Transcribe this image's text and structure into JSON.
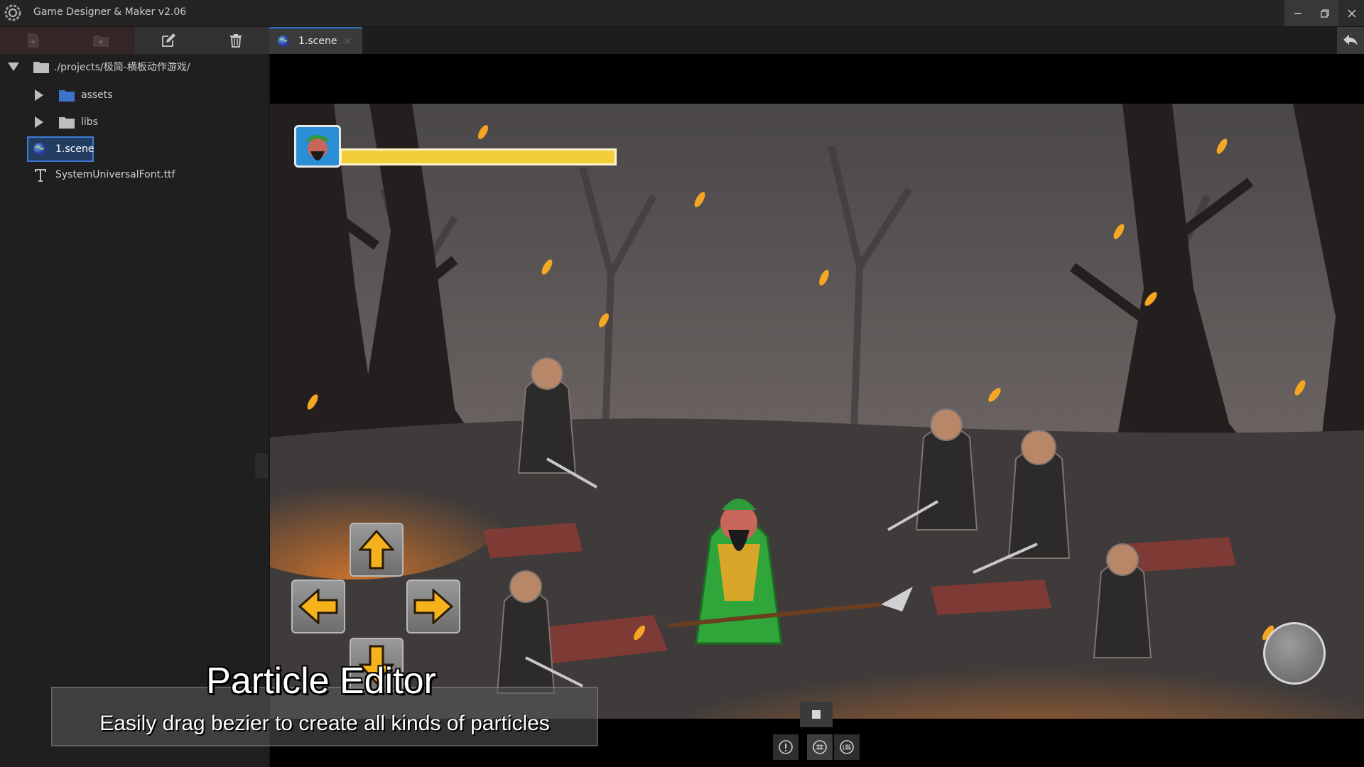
{
  "app": {
    "title": "Game Designer  &  Maker  v2.06"
  },
  "window_controls": {
    "minimize": "–",
    "maximize": "❐",
    "close": "✕"
  },
  "toolbar": {
    "icons": [
      "new-file-icon",
      "new-folder-icon",
      "edit-icon",
      "delete-icon"
    ]
  },
  "tabs": [
    {
      "label": "1.scene",
      "close": "✕",
      "active": true
    }
  ],
  "explorer": {
    "root": "./projects/极简-横板动作游戏/",
    "items": [
      {
        "label": "assets",
        "type": "folder",
        "color": "#3b73c8"
      },
      {
        "label": "libs",
        "type": "folder",
        "color": "#bdbdbd"
      },
      {
        "label": "1.scene",
        "type": "scene",
        "selected": true
      },
      {
        "label": "SystemUniversalFont.ttf",
        "type": "font"
      }
    ]
  },
  "game": {
    "hp_fraction": 1.0,
    "dpad": [
      "up-arrow-icon",
      "left-arrow-icon",
      "right-arrow-icon",
      "down-arrow-icon"
    ],
    "colors": {
      "hp": "#f2cf3a",
      "ember": "#f5a623",
      "ground": "#3f3b3a"
    }
  },
  "caption": {
    "title": "Particle Editor",
    "subtitle": "Easily drag bezier to create all kinds of particles"
  }
}
